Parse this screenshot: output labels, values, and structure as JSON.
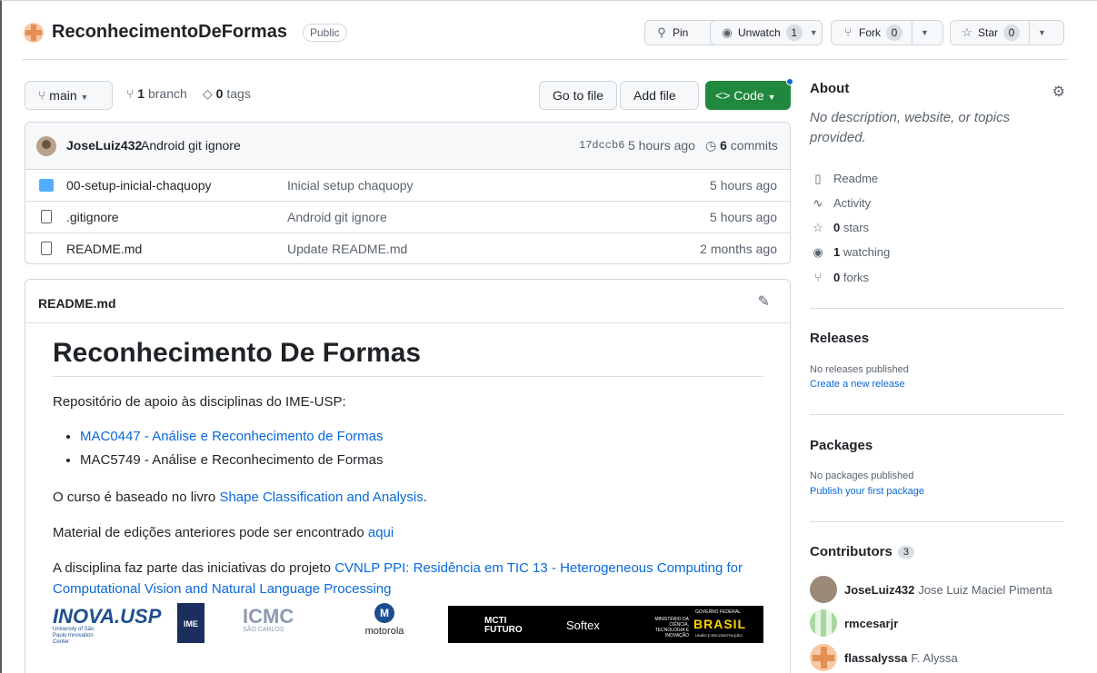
{
  "repo": {
    "name": "ReconhecimentoDeFormas",
    "visibility": "Public",
    "pin_label": "Pin",
    "unwatch_label": "Unwatch",
    "unwatch_count": "1",
    "fork_label": "Fork",
    "fork_count": "0",
    "star_label": "Star",
    "star_count": "0"
  },
  "toolbar": {
    "branch": "main",
    "branch_count": "1",
    "branch_word": "branch",
    "tag_count": "0",
    "tag_word": "tags",
    "go_to_file": "Go to file",
    "add_file": "Add file",
    "code": "Code"
  },
  "commit": {
    "user": "JoseLuiz432",
    "message": "Android git ignore",
    "hash": "17dccb6",
    "time": "5 hours ago",
    "count": "6",
    "count_word": "commits"
  },
  "files": [
    {
      "name": "00-setup-inicial-chaquopy",
      "message": "Inicial setup chaquopy",
      "age": "5 hours ago",
      "type": "folder"
    },
    {
      "name": ".gitignore",
      "message": "Android git ignore",
      "age": "5 hours ago",
      "type": "file"
    },
    {
      "name": "README.md",
      "message": "Update README.md",
      "age": "2 months ago",
      "type": "file"
    }
  ],
  "readme": {
    "file_title": "README.md",
    "h1": "Reconhecimento De Formas",
    "intro": "Repositório de apoio às disciplinas do IME-USP:",
    "courses": [
      "MAC0447 - Análise e Reconhecimento de Formas",
      "MAC5749 - Análise e Reconhecimento de Formas"
    ],
    "book_prefix": "O curso é baseado no livro ",
    "book_link": "Shape Classification and Analysis",
    "book_suffix": ".",
    "material_prefix": "Material de edições anteriores pode ser encontrado ",
    "material_link": "aqui",
    "project_prefix": "A disciplina faz parte das iniciativas do projeto ",
    "project_link": "CVNLP PPI: Residência em TIC 13 - Heterogeneous Computing for Computational Vision and Natural Language Processing",
    "logos": {
      "inova": "INOVA.USP",
      "inova_sub": "University of São Paulo Innovation Center",
      "ime": "IME",
      "icmc": "ICMC",
      "icmc_sub": "SÃO CARLOS",
      "motorola": "motorola",
      "mcti": "MCTI FUTURO",
      "softex": "Softex",
      "ministerio": "MINISTÉRIO DA CIÊNCIA, TECNOLOGIA E INOVAÇÃO",
      "brasil": "BRASIL",
      "gov": "GOVERNO FEDERAL",
      "gov_sub": "UNIÃO E RECONSTRUÇÃO"
    }
  },
  "about": {
    "title": "About",
    "description": "No description, website, or topics provided.",
    "readme": "Readme",
    "activity": "Activity",
    "stars_count": "0",
    "stars_word": "stars",
    "watching_count": "1",
    "watching_word": "watching",
    "forks_count": "0",
    "forks_word": "forks"
  },
  "releases": {
    "title": "Releases",
    "empty": "No releases published",
    "link": "Create a new release"
  },
  "packages": {
    "title": "Packages",
    "empty": "No packages published",
    "link": "Publish your first package"
  },
  "contributors": {
    "title": "Contributors",
    "count": "3",
    "list": [
      {
        "login": "JoseLuiz432",
        "name": "Jose Luiz Maciel Pimenta"
      },
      {
        "login": "rmcesarjr",
        "name": ""
      },
      {
        "login": "flassalyssa",
        "name": "F. Alyssa"
      }
    ]
  },
  "colors": {
    "accent_link": "#0969da",
    "code_button": "#1f883d",
    "folder": "#54aeff"
  }
}
